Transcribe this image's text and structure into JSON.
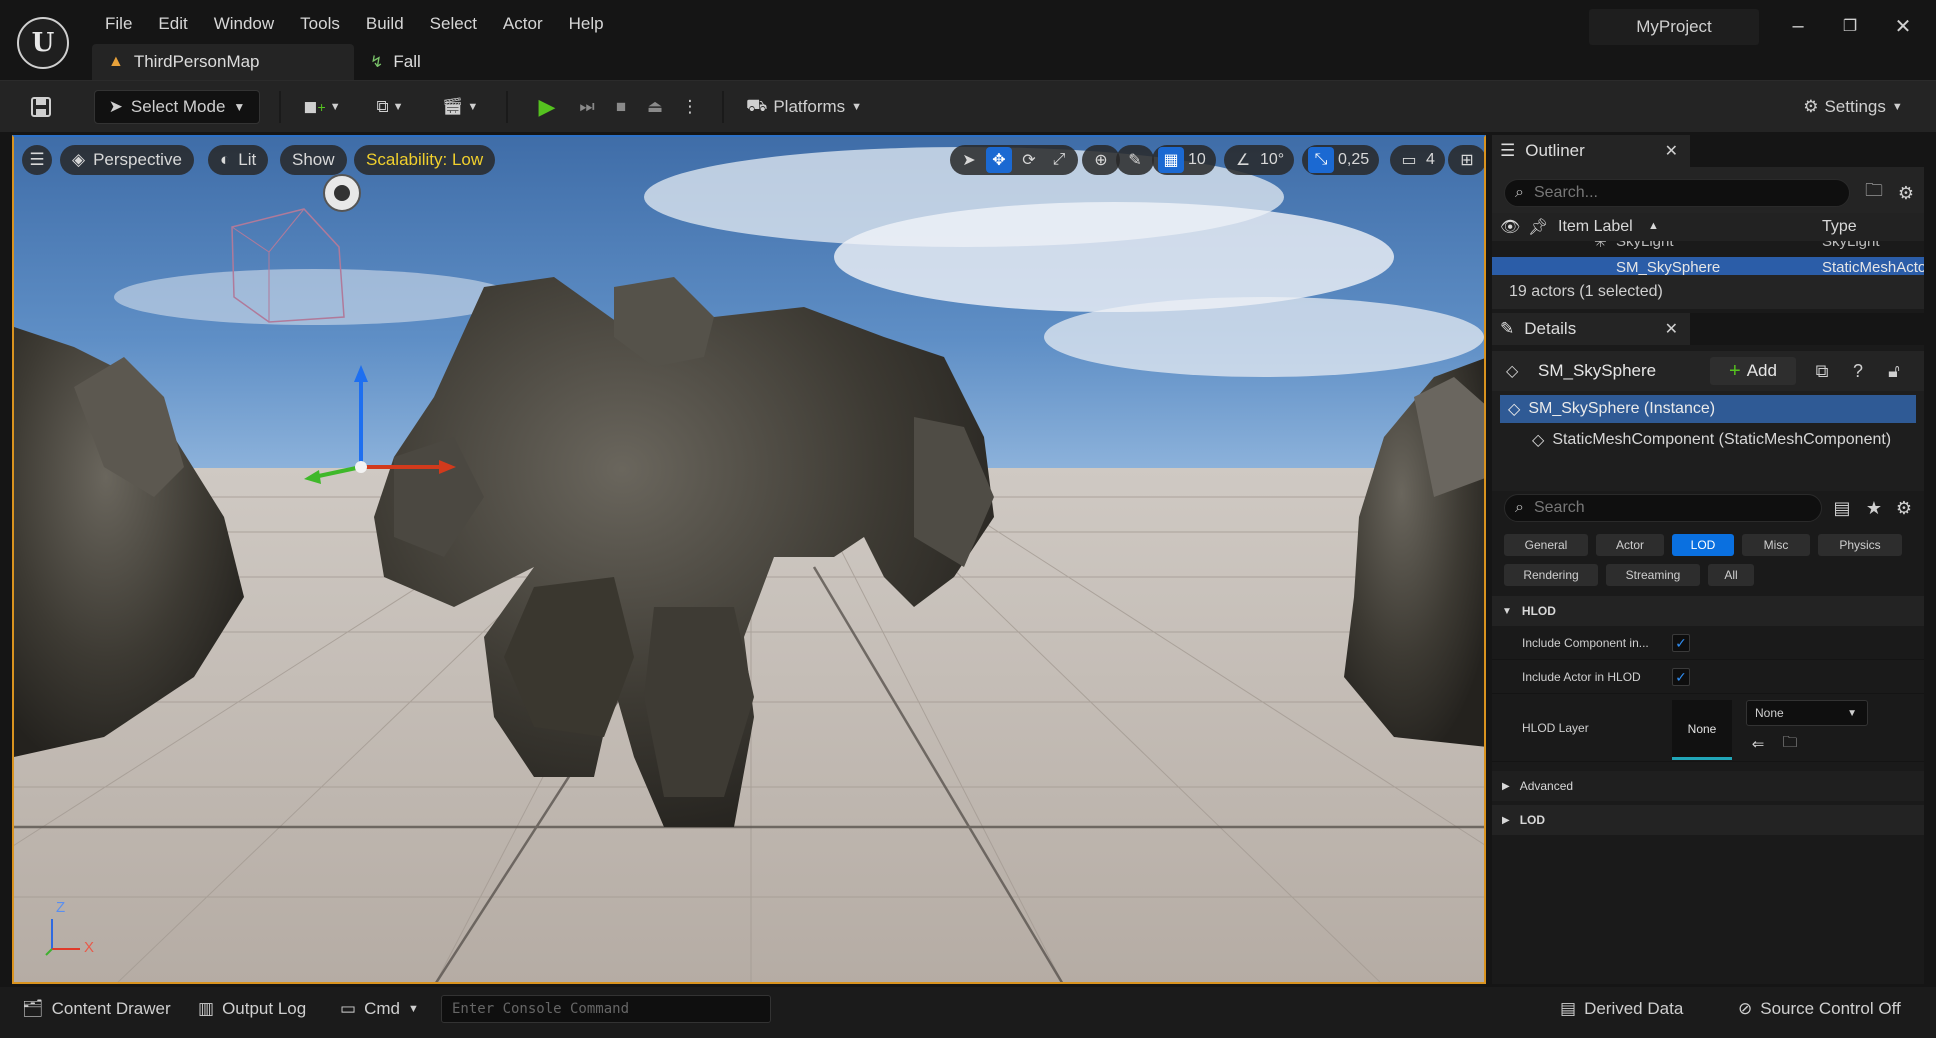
{
  "app": {
    "logo_text": "U",
    "project_name": "MyProject",
    "menu": [
      "File",
      "Edit",
      "Window",
      "Tools",
      "Build",
      "Select",
      "Actor",
      "Help"
    ],
    "tabs": [
      {
        "label": "ThirdPersonMap",
        "icon": "level-icon",
        "active": true
      },
      {
        "label": "Fall",
        "icon": "animation-icon",
        "active": false
      }
    ]
  },
  "toolbar": {
    "select_mode_label": "Select Mode",
    "platforms_label": "Platforms",
    "settings_label": "Settings"
  },
  "viewport": {
    "perspective_label": "Perspective",
    "lit_label": "Lit",
    "show_label": "Show",
    "scalability_label": "Scalability: Low",
    "grid_snap_value": "10",
    "rotation_snap_value": "10°",
    "scale_snap_value": "0,25",
    "camera_speed_value": "4",
    "axis_z": "Z",
    "axis_x": "X",
    "colors": {
      "accent": "#1b69d2",
      "scalability": "#f0cf2d",
      "border": "#d9931f"
    }
  },
  "outliner": {
    "title": "Outliner",
    "search_placeholder": "Search...",
    "col_label": "Item Label",
    "col_type": "Type",
    "rows": [
      {
        "label": "SkyLight",
        "type": "SkyLight"
      },
      {
        "label": "SM_SkySphere",
        "type": "StaticMeshActor"
      }
    ],
    "count_text": "19 actors (1 selected)"
  },
  "details": {
    "title": "Details",
    "actor_name": "SM_SkySphere",
    "add_label": "Add",
    "components": [
      {
        "label": "SM_SkySphere (Instance)",
        "selected": true
      },
      {
        "label": "StaticMeshComponent (StaticMeshComponent)",
        "selected": false
      }
    ],
    "search_placeholder": "Search",
    "filters_row1": [
      "General",
      "Actor",
      "LOD",
      "Misc",
      "Physics"
    ],
    "filters_row2": [
      "Rendering",
      "Streaming",
      "All"
    ],
    "active_filter": "LOD",
    "section_hlod": "HLOD",
    "prop_include_component": "Include Component in...",
    "prop_include_component_checked": true,
    "prop_include_actor": "Include Actor in HLOD",
    "prop_include_actor_checked": true,
    "prop_hlod_layer": "HLOD Layer",
    "hlod_layer_thumb": "None",
    "hlod_layer_value": "None",
    "section_advanced": "Advanced",
    "section_lod": "LOD"
  },
  "statusbar": {
    "content_drawer": "Content Drawer",
    "output_log": "Output Log",
    "cmd_label": "Cmd",
    "console_placeholder": "Enter Console Command",
    "derived_data": "Derived Data",
    "source_control": "Source Control Off"
  }
}
